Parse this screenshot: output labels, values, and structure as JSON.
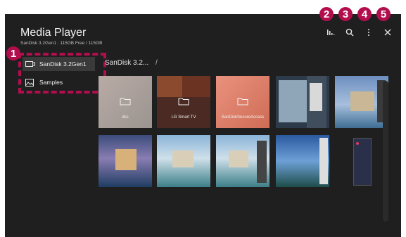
{
  "app": {
    "title": "Media Player",
    "storage": "SanDisk 3.2Gen1 : 115GB Free / 115GB"
  },
  "toolbar": {
    "sort_icon": "sort-icon",
    "search_icon": "search-icon",
    "more_icon": "more-icon",
    "close_icon": "close-icon"
  },
  "callouts": [
    "1",
    "2",
    "3",
    "4",
    "5"
  ],
  "sidebar": {
    "items": [
      {
        "label": "SanDisk 3.2Gen1",
        "icon": "usb-drive-icon",
        "selected": true
      },
      {
        "label": "Samples",
        "icon": "image-icon",
        "selected": false
      }
    ]
  },
  "breadcrumb": {
    "path": "SanDisk 3.2...",
    "separator": "/"
  },
  "folders": [
    "dsc",
    "LG Smart TV",
    "SanDiskSecureAccess"
  ],
  "colors": {
    "accent": "#b20d4d",
    "background": "#1f1f1f",
    "selected": "#3a3a3a"
  }
}
